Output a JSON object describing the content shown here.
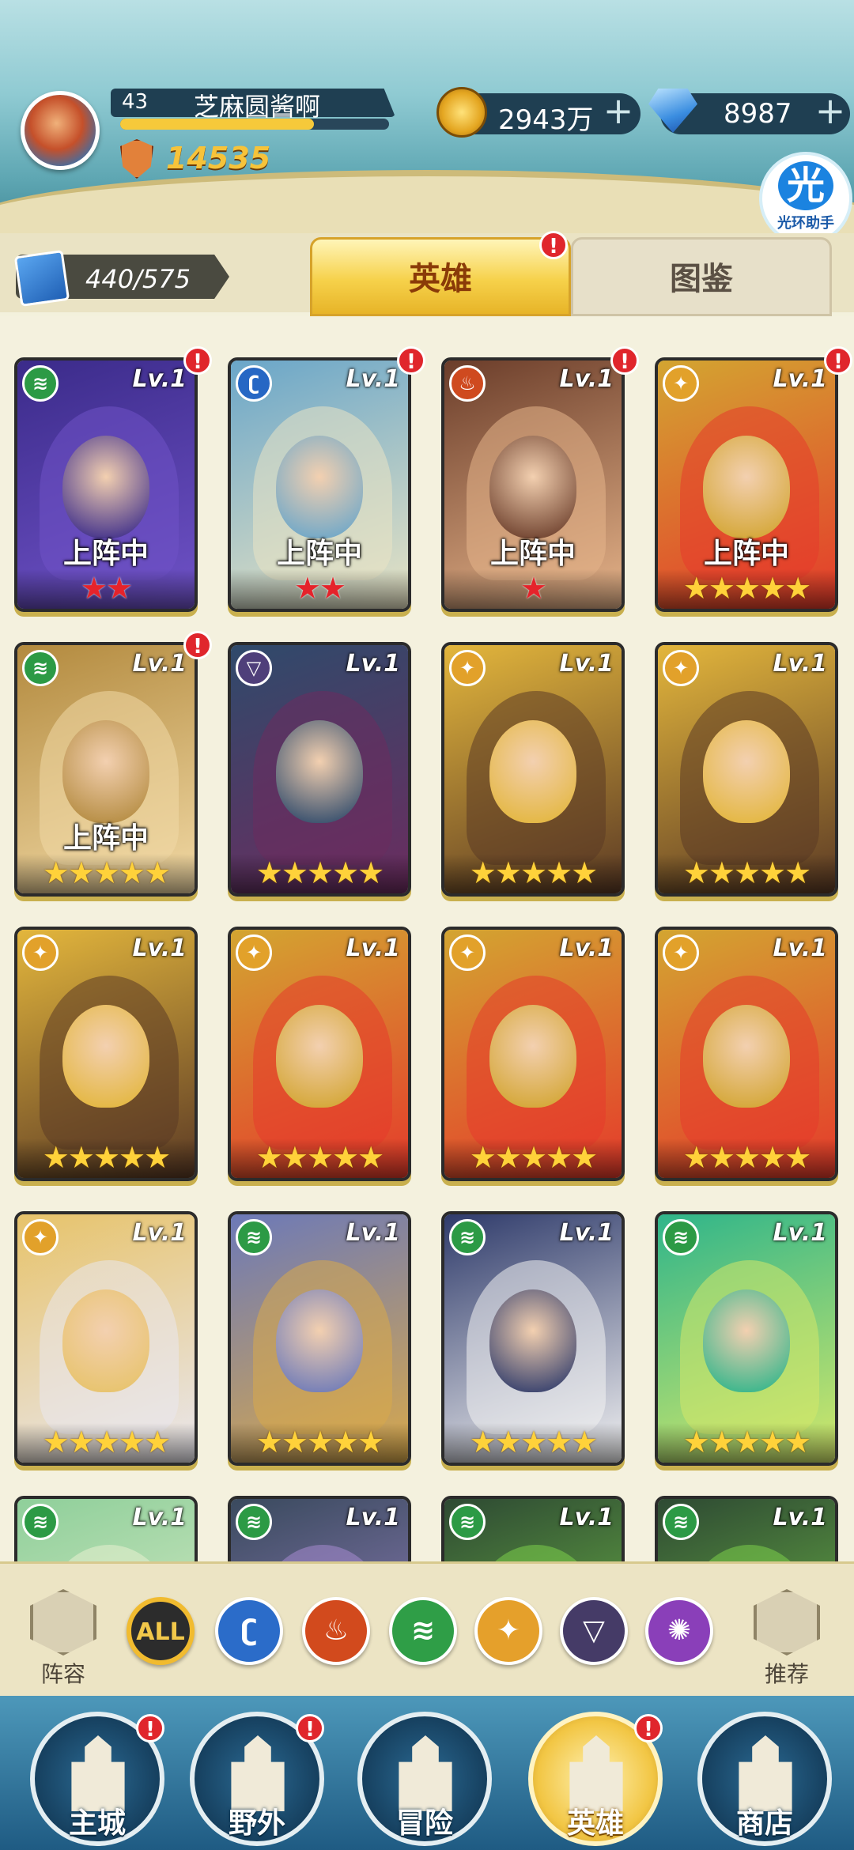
{
  "player": {
    "level": "43",
    "name": "芝麻圆酱啊",
    "power": "14535",
    "exp_progress": 0.72
  },
  "resources": {
    "gold": "2943万",
    "gems": "8987",
    "plus": "+"
  },
  "helper": {
    "icon_char": "光",
    "label": "光环助手"
  },
  "collection": {
    "count": "440/575"
  },
  "tabs": [
    {
      "label": "英雄",
      "active": true,
      "badge": "!"
    },
    {
      "label": "图鉴",
      "active": false
    }
  ],
  "cards": [
    {
      "element": "wind",
      "level": "Lv.1",
      "status": "上阵中",
      "stars": 2,
      "star_color": "red",
      "badge": "!",
      "colors": [
        "#3b2b8a",
        "#6f52c7"
      ]
    },
    {
      "element": "water",
      "level": "Lv.1",
      "status": "上阵中",
      "stars": 2,
      "star_color": "red",
      "badge": "!",
      "colors": [
        "#6aa6c9",
        "#e9e4c4"
      ]
    },
    {
      "element": "fire",
      "level": "Lv.1",
      "status": "上阵中",
      "stars": 1,
      "star_color": "red",
      "badge": "!",
      "colors": [
        "#6b3d2a",
        "#e6b48a"
      ]
    },
    {
      "element": "light",
      "level": "Lv.1",
      "status": "上阵中",
      "stars": 5,
      "star_color": "gold",
      "badge": "!",
      "colors": [
        "#d3a531",
        "#e53a2b"
      ]
    },
    {
      "element": "wind",
      "level": "Lv.1",
      "status": "上阵中",
      "stars": 5,
      "star_color": "gold",
      "badge": "!",
      "colors": [
        "#b38a3e",
        "#f1d9a5"
      ]
    },
    {
      "element": "dark",
      "level": "Lv.1",
      "status": "",
      "stars": 5,
      "star_color": "gold",
      "badge": "",
      "colors": [
        "#2f4a6b",
        "#6c2c5f"
      ]
    },
    {
      "element": "light",
      "level": "Lv.1",
      "status": "",
      "stars": 5,
      "star_color": "gold",
      "badge": "",
      "colors": [
        "#e3b63c",
        "#5b3a25"
      ]
    },
    {
      "element": "light",
      "level": "Lv.1",
      "status": "",
      "stars": 5,
      "star_color": "gold",
      "badge": "",
      "colors": [
        "#e3b63c",
        "#5b3a25"
      ]
    },
    {
      "element": "light",
      "level": "Lv.1",
      "status": "",
      "stars": 5,
      "star_color": "gold",
      "badge": "",
      "colors": [
        "#e3b63c",
        "#5b3a25"
      ]
    },
    {
      "element": "light",
      "level": "Lv.1",
      "status": "",
      "stars": 5,
      "star_color": "gold",
      "badge": "",
      "colors": [
        "#d3a531",
        "#e53a2b"
      ]
    },
    {
      "element": "light",
      "level": "Lv.1",
      "status": "",
      "stars": 5,
      "star_color": "gold",
      "badge": "",
      "colors": [
        "#d3a531",
        "#e53a2b"
      ]
    },
    {
      "element": "light",
      "level": "Lv.1",
      "status": "",
      "stars": 5,
      "star_color": "gold",
      "badge": "",
      "colors": [
        "#d3a531",
        "#e53a2b"
      ]
    },
    {
      "element": "light",
      "level": "Lv.1",
      "status": "",
      "stars": 5,
      "star_color": "gold",
      "badge": "",
      "colors": [
        "#e7c36a",
        "#e9e7ef"
      ]
    },
    {
      "element": "wind",
      "level": "Lv.1",
      "status": "",
      "stars": 5,
      "star_color": "gold",
      "badge": "",
      "colors": [
        "#6c79b8",
        "#d9a94a"
      ]
    },
    {
      "element": "wind",
      "level": "Lv.1",
      "status": "",
      "stars": 5,
      "star_color": "gold",
      "badge": "",
      "colors": [
        "#2f3b6b",
        "#f2f2f2"
      ]
    },
    {
      "element": "wind",
      "level": "Lv.1",
      "status": "",
      "stars": 5,
      "star_color": "gold",
      "badge": "",
      "colors": [
        "#2fb58a",
        "#d4e86a"
      ]
    },
    {
      "element": "wind",
      "level": "Lv.1",
      "status": "",
      "stars": 0,
      "star_color": "gold",
      "badge": "",
      "colors": [
        "#8fcf9a",
        "#e8f0d0"
      ]
    },
    {
      "element": "wind",
      "level": "Lv.1",
      "status": "",
      "stars": 0,
      "star_color": "gold",
      "badge": "",
      "colors": [
        "#3a4a5e",
        "#a58ad0"
      ]
    },
    {
      "element": "wind",
      "level": "Lv.1",
      "status": "",
      "stars": 0,
      "star_color": "gold",
      "badge": "",
      "colors": [
        "#2e4a33",
        "#7bd04a"
      ]
    },
    {
      "element": "wind",
      "level": "Lv.1",
      "status": "",
      "stars": 0,
      "star_color": "gold",
      "badge": "",
      "colors": [
        "#2e4a33",
        "#7bd04a"
      ]
    }
  ],
  "filters": {
    "lineup_label": "阵容",
    "recommend_label": "推荐",
    "items": [
      {
        "key": "all",
        "label": "ALL"
      },
      {
        "key": "water",
        "label": ""
      },
      {
        "key": "fire",
        "label": ""
      },
      {
        "key": "wind",
        "label": ""
      },
      {
        "key": "light",
        "label": ""
      },
      {
        "key": "dark",
        "label": ""
      },
      {
        "key": "void",
        "label": ""
      }
    ]
  },
  "nav": [
    {
      "label": "主城",
      "badge": "!",
      "active": false
    },
    {
      "label": "野外",
      "badge": "!",
      "active": false
    },
    {
      "label": "冒险",
      "badge": "",
      "active": false
    },
    {
      "label": "英雄",
      "badge": "!",
      "active": true
    },
    {
      "label": "商店",
      "badge": "",
      "active": false
    }
  ],
  "icons": {
    "power": "shield-icon",
    "gold": "coin-icon",
    "gems": "diamond-icon",
    "collection": "card-icon",
    "lineup": "lineup-icon",
    "recommend": "thumbs-up-icon"
  },
  "element_glyphs": {
    "wind": "≋",
    "water": "ʗ",
    "fire": "♨",
    "light": "✦",
    "dark": "▽",
    "void": "✺"
  }
}
